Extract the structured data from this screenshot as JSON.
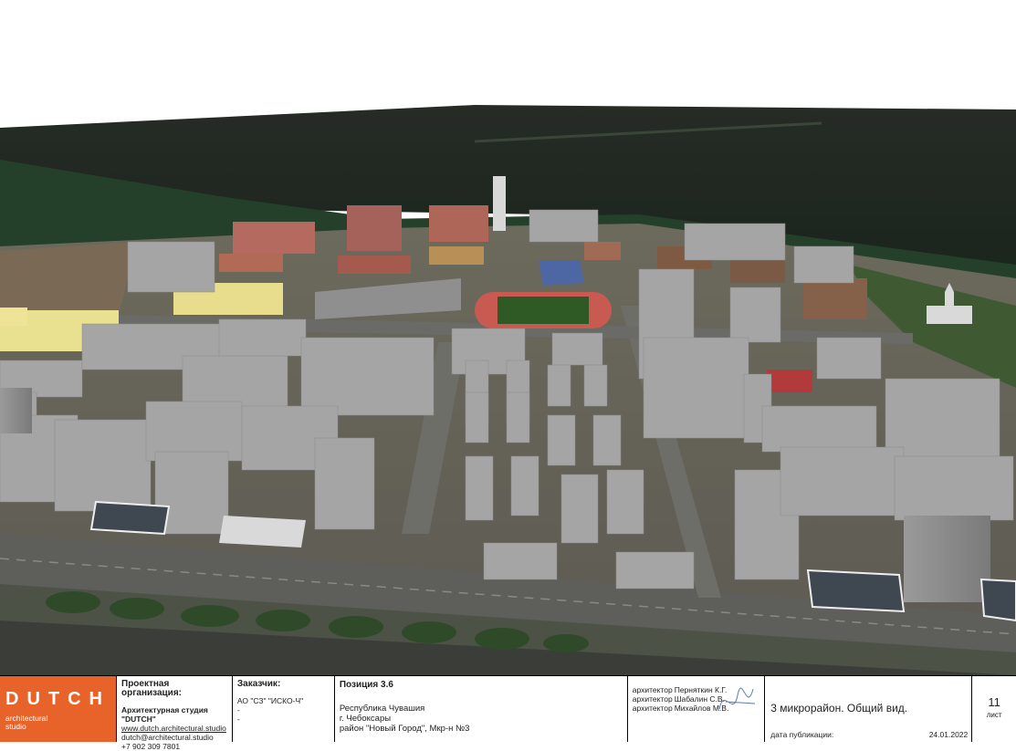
{
  "view": {
    "type": "3d-aerial-render",
    "colors": {
      "building": "#a4a4a4",
      "forest": "#1d2a1d",
      "stadium_track": "#c95a52",
      "field": "#2f5a25",
      "road": "#6a6a66",
      "logo_bg": "#e8632a"
    }
  },
  "logo": {
    "word": "DUTCH",
    "sub1": "architectural",
    "sub2": "studio"
  },
  "org": {
    "heading": "Проектная организация:",
    "name": "Архитектурная студия \"DUTCH\"",
    "site": "www.dutch.architectural.studio",
    "email": "dutch@architectural.studio",
    "phone": "+7 902 309 7801"
  },
  "client": {
    "heading": "Заказчик:",
    "name": "АО \"СЗ\" \"ИСКО-Ч\"",
    "line2": "-",
    "line3": "-"
  },
  "position": {
    "heading": "Позиция 3.6",
    "line1": "Республика Чувашия",
    "line2": "г. Чебоксары",
    "line3": "район \"Новый Город\", Мкр-н №3"
  },
  "architects": [
    {
      "role": "архитектор",
      "name": "Перняткин К.Г."
    },
    {
      "role": "архитектор",
      "name": "Шабалин С.В."
    },
    {
      "role": "архитектор",
      "name": "Михайлов М.В."
    }
  ],
  "sheet": {
    "title": "3 микрорайон. Общий вид.",
    "pub_label": "дата публикации:",
    "pub_date": "24.01.2022",
    "number": "11",
    "number_label": "лист"
  }
}
